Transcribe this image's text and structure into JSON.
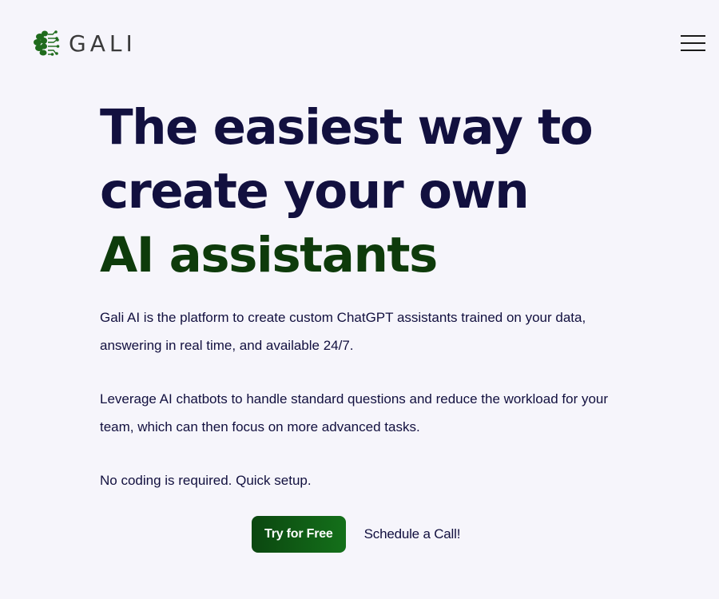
{
  "header": {
    "logo_text": "GALI",
    "menu_icon": "hamburger-menu-icon",
    "logo_icon": "brain-circuit-icon"
  },
  "hero": {
    "headline_line1": "The easiest way to",
    "headline_line2": "create your own",
    "headline_accent": "AI assistants",
    "paragraph1": "Gali AI is the platform to create custom ChatGPT assistants trained on your data, answering in real time, and available 24/7.",
    "paragraph2": "Leverage AI chatbots to handle standard questions and reduce the workload for your team, which can then focus on more advanced tasks.",
    "paragraph3": "No coding is required. Quick setup."
  },
  "cta": {
    "primary_label": "Try for Free",
    "secondary_label": "Schedule a Call!"
  },
  "colors": {
    "background": "#f6f5fb",
    "text": "#12103f",
    "accent_green": "#0e3b0b",
    "button_green": "#0b4710"
  }
}
